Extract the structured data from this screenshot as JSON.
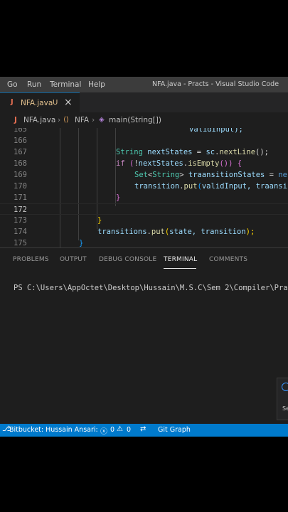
{
  "menu": {
    "items": [
      {
        "label": "Go"
      },
      {
        "label": "Run"
      },
      {
        "label": "Terminal"
      },
      {
        "label": "Help"
      }
    ],
    "window_title": "NFA.java - Practs - Visual Studio Code"
  },
  "tab": {
    "icon_text": "J",
    "label": "NFA.java",
    "badge": "U",
    "close": "×"
  },
  "breadcrumb": {
    "file_icon": "J",
    "file": "NFA.java",
    "sep1": "›",
    "class_icon": "⟨⟩",
    "class_name": "NFA",
    "sep2": "›",
    "method_icon": "◈",
    "method": "main(String[])"
  },
  "editor": {
    "lines": [
      {
        "n": "165",
        "partial": "validInput);"
      },
      {
        "n": "166"
      },
      {
        "n": "167"
      },
      {
        "n": "168"
      },
      {
        "n": "169"
      },
      {
        "n": "170"
      },
      {
        "n": "171"
      },
      {
        "n": "172"
      },
      {
        "n": "173"
      },
      {
        "n": "174"
      },
      {
        "n": "175"
      }
    ],
    "tokens": {
      "t167_type": "String",
      "t167_var": "nextStates",
      "t167_eq": " = ",
      "t167_obj": "sc",
      "t167_dot": ".",
      "t167_fn": "nextLine",
      "t167_end": "();",
      "t168_if": "if",
      "t168_open": " (",
      "t168_not": "!",
      "t168_var": "nextStates",
      "t168_dot": ".",
      "t168_fn": "isEmpty",
      "t168_end": "()) {",
      "t169_type1": "Set",
      "t169_lt": "<",
      "t169_type2": "String",
      "t169_gt": "> ",
      "t169_var": "traansitionStates",
      "t169_eq": " = ",
      "t169_new": "ne",
      "t170_var": "transition",
      "t170_dot": ".",
      "t170_fn": "put",
      "t170_open": "(",
      "t170_arg": "validInput, traansi",
      "t171_close": "}",
      "t173_close": "}",
      "t174_var": "transitions",
      "t174_dot": ".",
      "t174_fn": "put",
      "t174_open": "(",
      "t174_args": "state, transition",
      "t174_end": ");",
      "t175_close": "}"
    }
  },
  "panel": {
    "tabs": [
      {
        "label": "PROBLEMS"
      },
      {
        "label": "OUTPUT"
      },
      {
        "label": "DEBUG CONSOLE"
      },
      {
        "label": "TERMINAL"
      },
      {
        "label": "COMMENTS"
      }
    ],
    "terminal_prompt": "PS C:\\Users\\AppOctet\\Desktop\\Hussain\\M.S.C\\Sem 2\\Compiler\\Pra"
  },
  "notification": {
    "text": "Se"
  },
  "statusbar": {
    "branch_icon": "⎇",
    "bitbucket": "Bitbucket: Hussain Ansari:",
    "errors_icon": "ⓧ",
    "errors": "0",
    "warnings_icon": "⚠",
    "warnings": "0",
    "git_icon": "⇄",
    "git_graph": "Git Graph"
  },
  "colors": {
    "statusbar": "#007acc",
    "titlebar": "#3c3c3c",
    "editor_bg": "#1e1e1e",
    "modified_file": "#e2c08d",
    "java_icon": "#e76f52"
  }
}
